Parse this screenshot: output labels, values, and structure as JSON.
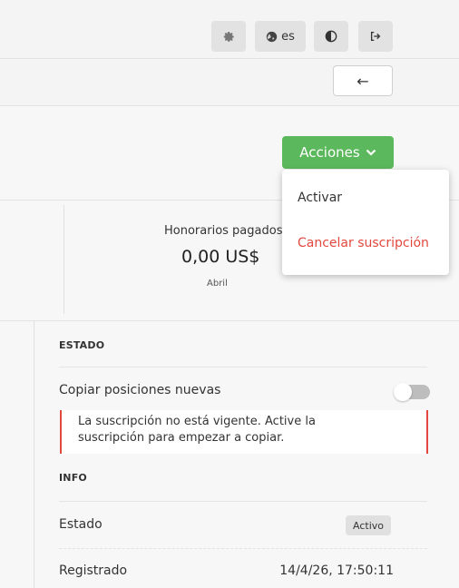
{
  "topbar": {
    "buttons": [
      {
        "icon": "gear-icon"
      },
      {
        "icon": "globe-icon",
        "label": "es"
      },
      {
        "icon": "contrast-icon"
      },
      {
        "icon": "logout-icon"
      }
    ]
  },
  "backbar": {
    "icon": "arrow-left-icon",
    "label": "←"
  },
  "actions": {
    "label": "Acciones",
    "icon": "chevron-down-icon",
    "menu": [
      "Activar",
      "Cancelar suscripción"
    ]
  },
  "stats": {
    "label": "Honorarios pagados",
    "value": "0,00 US$",
    "sub": "Abril"
  },
  "estado": {
    "title": "ESTADO",
    "copy_label": "Copiar posiciones nuevas",
    "copy_enabled": false,
    "alert_line1": "La suscripción no está vigente. Active la",
    "alert_line2": "suscripción para empezar a copiar."
  },
  "info": {
    "title": "INFO",
    "status_label": "Estado",
    "status_value": "Activo",
    "registered_label": "Registrado",
    "registered_value": "14/4/26, 17:50:11"
  },
  "colors": {
    "accent_green": "#5cb85c",
    "danger_red": "#e2483d"
  }
}
